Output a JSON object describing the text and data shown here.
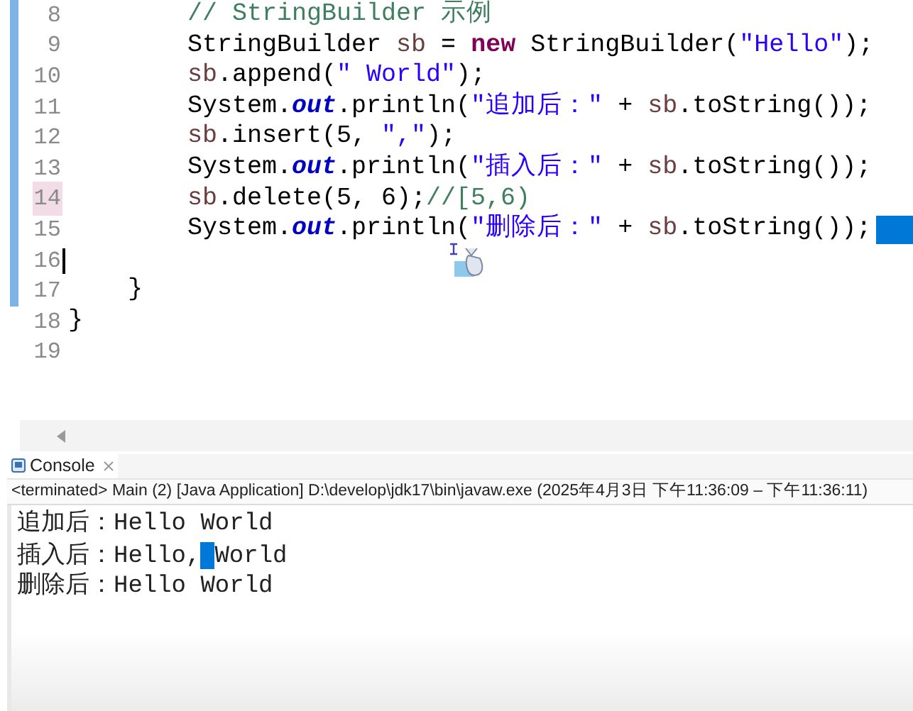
{
  "editor": {
    "lines": [
      {
        "number": "8",
        "marked": true,
        "highlighted": false,
        "caret": false,
        "kind": "body",
        "tokens": [
          {
            "kind": "comment",
            "text": "// StringBuilder 示例"
          }
        ]
      },
      {
        "number": "9",
        "marked": true,
        "highlighted": false,
        "caret": false,
        "kind": "body",
        "tokens": [
          {
            "kind": "plain",
            "text": "StringBuilder "
          },
          {
            "kind": "var",
            "text": "sb"
          },
          {
            "kind": "plain",
            "text": " = "
          },
          {
            "kind": "keyword",
            "text": "new"
          },
          {
            "kind": "plain",
            "text": " StringBuilder("
          },
          {
            "kind": "string",
            "text": "\"Hello\""
          },
          {
            "kind": "plain",
            "text": ");"
          }
        ]
      },
      {
        "number": "10",
        "marked": true,
        "highlighted": false,
        "caret": false,
        "kind": "body",
        "tokens": [
          {
            "kind": "var",
            "text": "sb"
          },
          {
            "kind": "plain",
            "text": ".append("
          },
          {
            "kind": "string",
            "text": "\" World\""
          },
          {
            "kind": "plain",
            "text": ");"
          }
        ]
      },
      {
        "number": "11",
        "marked": true,
        "highlighted": false,
        "caret": false,
        "kind": "body",
        "tokens": [
          {
            "kind": "plain",
            "text": "System."
          },
          {
            "kind": "field",
            "text": "out"
          },
          {
            "kind": "plain",
            "text": ".println("
          },
          {
            "kind": "string",
            "text": "\"追加后：\""
          },
          {
            "kind": "plain",
            "text": " + "
          },
          {
            "kind": "var",
            "text": "sb"
          },
          {
            "kind": "plain",
            "text": ".toString());"
          }
        ]
      },
      {
        "number": "12",
        "marked": true,
        "highlighted": false,
        "caret": false,
        "kind": "body",
        "tokens": [
          {
            "kind": "var",
            "text": "sb"
          },
          {
            "kind": "plain",
            "text": ".insert(5, "
          },
          {
            "kind": "string",
            "text": "\",\""
          },
          {
            "kind": "plain",
            "text": ");"
          }
        ]
      },
      {
        "number": "13",
        "marked": true,
        "highlighted": false,
        "caret": false,
        "kind": "body",
        "tokens": [
          {
            "kind": "plain",
            "text": "System."
          },
          {
            "kind": "field",
            "text": "out"
          },
          {
            "kind": "plain",
            "text": ".println("
          },
          {
            "kind": "string",
            "text": "\"插入后：\""
          },
          {
            "kind": "plain",
            "text": " + "
          },
          {
            "kind": "var",
            "text": "sb"
          },
          {
            "kind": "plain",
            "text": ".toString());"
          }
        ]
      },
      {
        "number": "14",
        "marked": true,
        "highlighted": true,
        "caret": false,
        "kind": "body",
        "tokens": [
          {
            "kind": "var",
            "text": "sb"
          },
          {
            "kind": "plain",
            "text": ".delete(5, 6);"
          },
          {
            "kind": "comment",
            "text": "//[5,6)"
          }
        ]
      },
      {
        "number": "15",
        "marked": true,
        "highlighted": false,
        "caret": false,
        "kind": "body",
        "selection_tail": true,
        "tokens": [
          {
            "kind": "plain",
            "text": "System."
          },
          {
            "kind": "field",
            "text": "out"
          },
          {
            "kind": "plain",
            "text": ".println("
          },
          {
            "kind": "string",
            "text": "\"删除后：\""
          },
          {
            "kind": "plain",
            "text": " + "
          },
          {
            "kind": "var",
            "text": "sb"
          },
          {
            "kind": "plain",
            "text": ".toString());"
          }
        ]
      },
      {
        "number": "16",
        "marked": true,
        "highlighted": false,
        "caret": true
      },
      {
        "number": "17",
        "marked": true,
        "highlighted": false,
        "caret": false,
        "kind": "method",
        "tokens": [
          {
            "kind": "plain",
            "text": "}"
          }
        ]
      },
      {
        "number": "18",
        "marked": false,
        "highlighted": false,
        "caret": false,
        "kind": "class",
        "tokens": [
          {
            "kind": "plain",
            "text": "}"
          }
        ]
      },
      {
        "number": "19",
        "marked": false,
        "highlighted": false,
        "caret": false
      }
    ]
  },
  "console": {
    "tab": {
      "label": "Console",
      "selected": true
    },
    "header": "<terminated> Main (2) [Java Application] D:\\develop\\jdk17\\bin\\javaw.exe  (2025年4月3日 下午11:36:09 – 下午11:36:11)",
    "output": [
      [
        {
          "text": "追加后：Hello World"
        }
      ],
      [
        {
          "text": "插入后：Hello,"
        },
        {
          "kind": "selection"
        },
        {
          "text": "World"
        }
      ],
      [
        {
          "text": "删除后：Hello World"
        }
      ]
    ]
  }
}
